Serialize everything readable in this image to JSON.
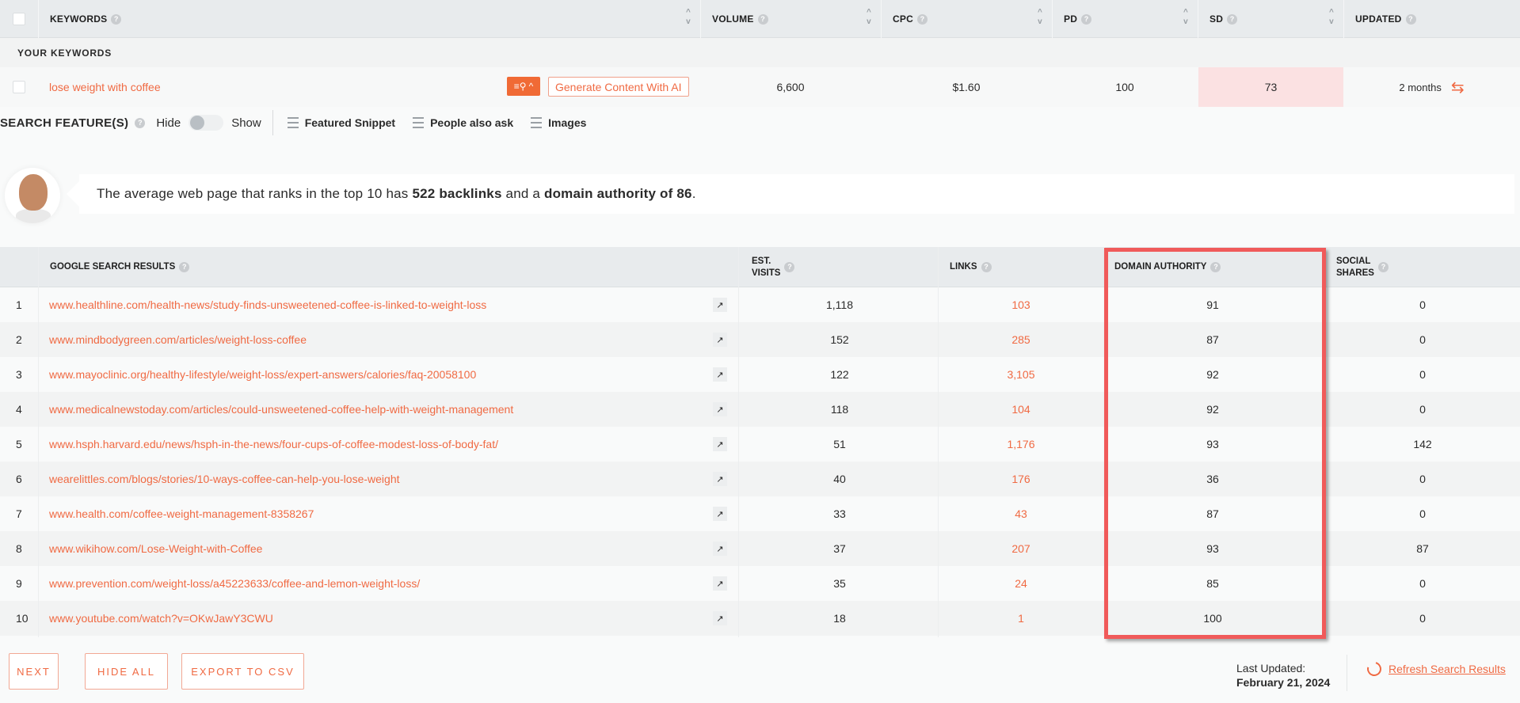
{
  "keywords_table": {
    "headers": {
      "keywords": "KEYWORDS",
      "volume": "VOLUME",
      "cpc": "CPC",
      "pd": "PD",
      "sd": "SD",
      "updated": "UPDATED"
    },
    "section_label": "YOUR KEYWORDS",
    "row": {
      "keyword": "lose weight with coffee",
      "generate_button": "Generate Content With AI",
      "volume": "6,600",
      "cpc": "$1.60",
      "pd": "100",
      "sd": "73",
      "updated": "2 months"
    },
    "colors": {
      "accent": "#f06a43",
      "sd_highlight": "#fbe1e2"
    }
  },
  "search_features": {
    "title": "SEARCH FEATURE(S)",
    "hide_label": "Hide",
    "show_label": "Show",
    "toggle_state": "hide",
    "features": [
      "Featured Snippet",
      "People also ask",
      "Images"
    ]
  },
  "tip": {
    "prefix": "The average web page that ranks in the top 10 has ",
    "backlinks": "522 backlinks",
    "middle": " and a ",
    "domain_authority": "domain authority of 86",
    "suffix": "."
  },
  "results_table": {
    "headers": {
      "google_search_results": "GOOGLE SEARCH RESULTS",
      "est_visits_line1": "EST.",
      "est_visits_line2": "VISITS",
      "links": "LINKS",
      "domain_authority": "DOMAIN AUTHORITY",
      "social_shares_line1": "SOCIAL",
      "social_shares_line2": "SHARES"
    },
    "rows": [
      {
        "rank": "1",
        "url": "www.healthline.com/health-news/study-finds-unsweetened-coffee-is-linked-to-weight-loss",
        "visits": "1,118",
        "links": "103",
        "da": "91",
        "social": "0"
      },
      {
        "rank": "2",
        "url": "www.mindbodygreen.com/articles/weight-loss-coffee",
        "visits": "152",
        "links": "285",
        "da": "87",
        "social": "0"
      },
      {
        "rank": "3",
        "url": "www.mayoclinic.org/healthy-lifestyle/weight-loss/expert-answers/calories/faq-20058100",
        "visits": "122",
        "links": "3,105",
        "da": "92",
        "social": "0"
      },
      {
        "rank": "4",
        "url": "www.medicalnewstoday.com/articles/could-unsweetened-coffee-help-with-weight-management",
        "visits": "118",
        "links": "104",
        "da": "92",
        "social": "0"
      },
      {
        "rank": "5",
        "url": "www.hsph.harvard.edu/news/hsph-in-the-news/four-cups-of-coffee-modest-loss-of-body-fat/",
        "visits": "51",
        "links": "1,176",
        "da": "93",
        "social": "142"
      },
      {
        "rank": "6",
        "url": "wearelittles.com/blogs/stories/10-ways-coffee-can-help-you-lose-weight",
        "visits": "40",
        "links": "176",
        "da": "36",
        "social": "0"
      },
      {
        "rank": "7",
        "url": "www.health.com/coffee-weight-management-8358267",
        "visits": "33",
        "links": "43",
        "da": "87",
        "social": "0"
      },
      {
        "rank": "8",
        "url": "www.wikihow.com/Lose-Weight-with-Coffee",
        "visits": "37",
        "links": "207",
        "da": "93",
        "social": "87"
      },
      {
        "rank": "9",
        "url": "www.prevention.com/weight-loss/a45223633/coffee-and-lemon-weight-loss/",
        "visits": "35",
        "links": "24",
        "da": "85",
        "social": "0"
      },
      {
        "rank": "10",
        "url": "www.youtube.com/watch?v=OKwJawY3CWU",
        "visits": "18",
        "links": "1",
        "da": "100",
        "social": "0"
      }
    ],
    "highlight_color": "#f05a5a"
  },
  "footer": {
    "next": "NEXT",
    "hide_all": "HIDE ALL",
    "export_csv": "EXPORT TO CSV",
    "last_updated_label": "Last Updated:",
    "last_updated_date": "February 21, 2024",
    "refresh": "Refresh Search Results"
  }
}
